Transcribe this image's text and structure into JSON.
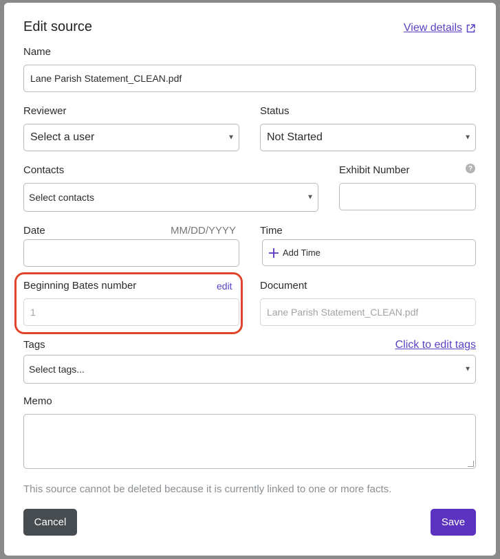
{
  "modal": {
    "title": "Edit source",
    "view_details": "View details"
  },
  "fields": {
    "name": {
      "label": "Name",
      "value": "Lane Parish Statement_CLEAN.pdf"
    },
    "reviewer": {
      "label": "Reviewer",
      "value": "Select a user"
    },
    "status": {
      "label": "Status",
      "value": "Not Started"
    },
    "contacts": {
      "label": "Contacts",
      "value": "Select contacts"
    },
    "exhibit_number": {
      "label": "Exhibit Number",
      "value": ""
    },
    "date": {
      "label": "Date",
      "hint": "MM/DD/YYYY",
      "value": ""
    },
    "time": {
      "label": "Time",
      "button": "Add Time"
    },
    "bates": {
      "label": "Beginning Bates number",
      "edit": "edit",
      "value": "1"
    },
    "document": {
      "label": "Document",
      "value": "Lane Parish Statement_CLEAN.pdf"
    },
    "tags": {
      "label": "Tags",
      "edit_link": "Click to edit tags",
      "value": "Select tags..."
    },
    "memo": {
      "label": "Memo",
      "value": ""
    }
  },
  "note": "This source cannot be deleted because it is currently linked to one or more facts.",
  "buttons": {
    "cancel": "Cancel",
    "save": "Save"
  },
  "colors": {
    "accent": "#5b33c0",
    "highlight": "#e0442b",
    "cancel": "#474c51"
  },
  "icons": [
    "external-link-icon",
    "help-icon",
    "plus-icon",
    "caret-down-icon"
  ]
}
